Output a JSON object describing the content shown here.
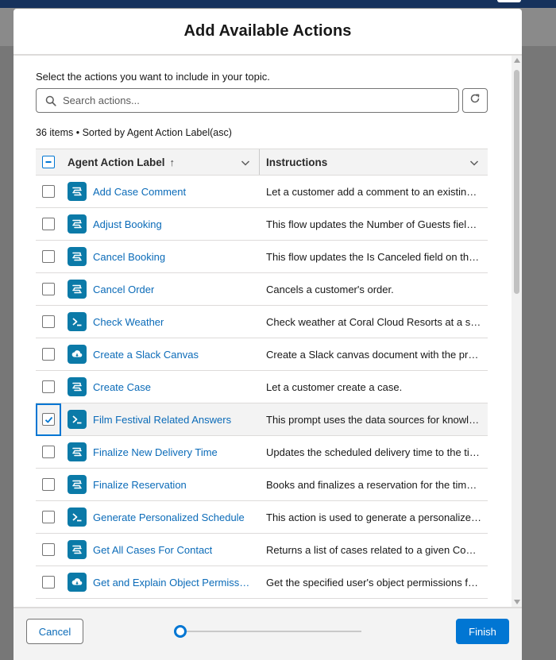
{
  "modal": {
    "title": "Add Available Actions",
    "intro": "Select the actions you want to include in your topic.",
    "search": {
      "placeholder": "Search actions...",
      "value": ""
    },
    "summary": "36 items • Sorted by Agent Action Label(asc)",
    "columns": {
      "label": "Agent Action Label",
      "label_sort": "↑",
      "instructions": "Instructions"
    },
    "rows": [
      {
        "label": "Add Case Comment",
        "instructions": "Let a customer add a comment to an existing case.",
        "icon": "flow-icon",
        "checked": false
      },
      {
        "label": "Adjust Booking",
        "instructions": "This flow updates the Number of Guests field on the booking.",
        "icon": "flow-icon",
        "checked": false
      },
      {
        "label": "Cancel Booking",
        "instructions": "This flow updates the Is Canceled field on the booking.",
        "icon": "flow-icon",
        "checked": false
      },
      {
        "label": "Cancel Order",
        "instructions": "Cancels a customer's order.",
        "icon": "flow-icon",
        "checked": false
      },
      {
        "label": "Check Weather",
        "instructions": "Check weather at Coral Cloud Resorts at a specific date.",
        "icon": "prompt-icon",
        "checked": false
      },
      {
        "label": "Create a Slack Canvas",
        "instructions": "Create a Slack canvas document with the provided content.",
        "icon": "apex-icon",
        "checked": false
      },
      {
        "label": "Create Case",
        "instructions": "Let a customer create a case.",
        "icon": "flow-icon",
        "checked": false
      },
      {
        "label": "Film Festival Related Answers",
        "instructions": "This prompt uses the data sources for knowledge answers.",
        "icon": "prompt-icon",
        "checked": true
      },
      {
        "label": "Finalize New Delivery Time",
        "instructions": "Updates the scheduled delivery time to the time selected.",
        "icon": "flow-icon",
        "checked": false
      },
      {
        "label": "Finalize Reservation",
        "instructions": "Books and finalizes a reservation for the time selected.",
        "icon": "flow-icon",
        "checked": false
      },
      {
        "label": "Generate Personalized Schedule",
        "instructions": "This action is used to generate a personalized schedule.",
        "icon": "prompt-icon",
        "checked": false
      },
      {
        "label": "Get All Cases For Contact",
        "instructions": "Returns a list of cases related to a given Contact.",
        "icon": "flow-icon",
        "checked": false
      },
      {
        "label": "Get and Explain Object Permissions",
        "instructions": "Get the specified user's object permissions for an object.",
        "icon": "apex-icon",
        "checked": false
      }
    ],
    "footer": {
      "cancel_label": "Cancel",
      "finish_label": "Finish",
      "progress": 0
    }
  },
  "colors": {
    "brand": "#0176d3",
    "link": "#0b6bb8",
    "icon_bg": "#0b7aa8"
  }
}
